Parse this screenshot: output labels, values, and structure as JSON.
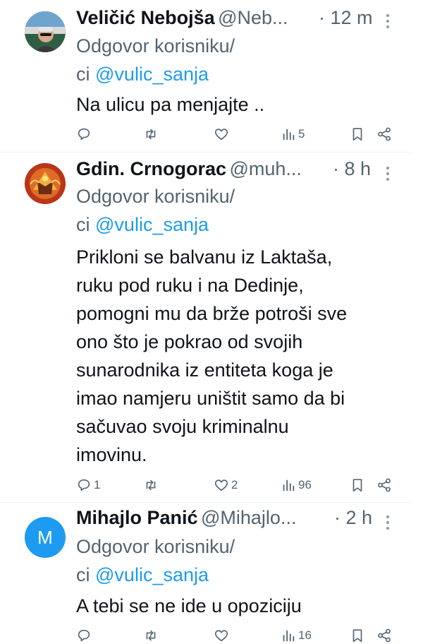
{
  "tweets": [
    {
      "name": "Veličić Nebojša",
      "handle": "@Neb...",
      "time": "· 12 m",
      "reply_prefix_1": "Odgovor korisniku/",
      "reply_prefix_2": "ci",
      "mention": "@vulic_sanja",
      "text": [
        "Na ulicu pa menjajte .."
      ],
      "replies": "",
      "retweets": "",
      "likes": "",
      "views": "5",
      "avatar_type": "photo"
    },
    {
      "name": "Gdin. Crnogorac",
      "handle": "@muh...",
      "time": "· 8 h",
      "reply_prefix_1": "Odgovor korisniku/",
      "reply_prefix_2": "ci",
      "mention": "@vulic_sanja",
      "text": [
        "Prikloni se balvanu iz Laktaša,",
        "ruku pod ruku i na Dedinje,",
        "pomogni mu da brže potroši sve",
        "ono što je pokrao od svojih",
        "sunarodnika iz entiteta koga je",
        "imao namjeru uništit samo da bi",
        "sačuvao svoju kriminalnu",
        "imovinu."
      ],
      "replies": "1",
      "retweets": "",
      "likes": "2",
      "views": "96",
      "avatar_type": "emblem"
    },
    {
      "name": "Mihajlo Panić",
      "handle": "@Mihajlo...",
      "time": "· 2 h",
      "reply_prefix_1": "Odgovor korisniku/",
      "reply_prefix_2": "ci",
      "mention": "@vulic_sanja",
      "text": [
        "A tebi se ne ide u opoziciju"
      ],
      "replies": "",
      "retweets": "",
      "likes": "",
      "views": "16",
      "avatar_letter": "M",
      "avatar_type": "letter"
    }
  ],
  "colors": {
    "accent": "#1d9bf0",
    "secondary": "#536471",
    "avatar_letter_bg": "#1d9bf0"
  },
  "icons": [
    "reply-icon",
    "retweet-icon",
    "like-icon",
    "views-icon",
    "bookmark-icon",
    "share-icon",
    "more-icon"
  ]
}
